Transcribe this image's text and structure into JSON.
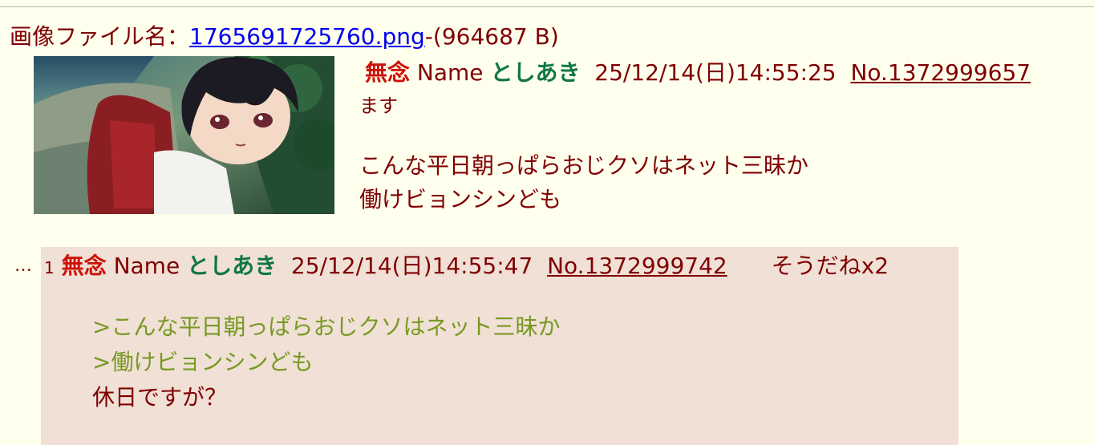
{
  "file": {
    "label": "画像ファイル名：",
    "filename": "1765691725760.png",
    "size": "-(964687 B)"
  },
  "op": {
    "subject": "無念",
    "name_label": "Name",
    "name": "としあき",
    "datetime": "25/12/14(日)14:55:25",
    "number": "No.1372999657",
    "sub_text": "ます",
    "body_lines": [
      "こんな平日朝っぱらおじクソはネット三昧か",
      "働けビョンシンども"
    ]
  },
  "reply": {
    "dots": "…",
    "index": "1",
    "subject": "無念",
    "name_label": "Name",
    "name": "としあき",
    "datetime": "25/12/14(日)14:55:47",
    "number": "No.1372999742",
    "sodane": "そうだねx2",
    "quotes": [
      ">こんな平日朝っぱらおじクソはネット三昧か",
      ">働けビョンシンども"
    ],
    "text": "休日ですが？"
  },
  "colors": {
    "background": "#ffffee",
    "reply_background": "#f0e0d6",
    "text": "#800000",
    "subject": "#cc1105",
    "name": "#117743",
    "quote": "#789922",
    "link": "#0000ee"
  },
  "icons": {
    "thumbnail": "anime-girl-thumbnail"
  }
}
